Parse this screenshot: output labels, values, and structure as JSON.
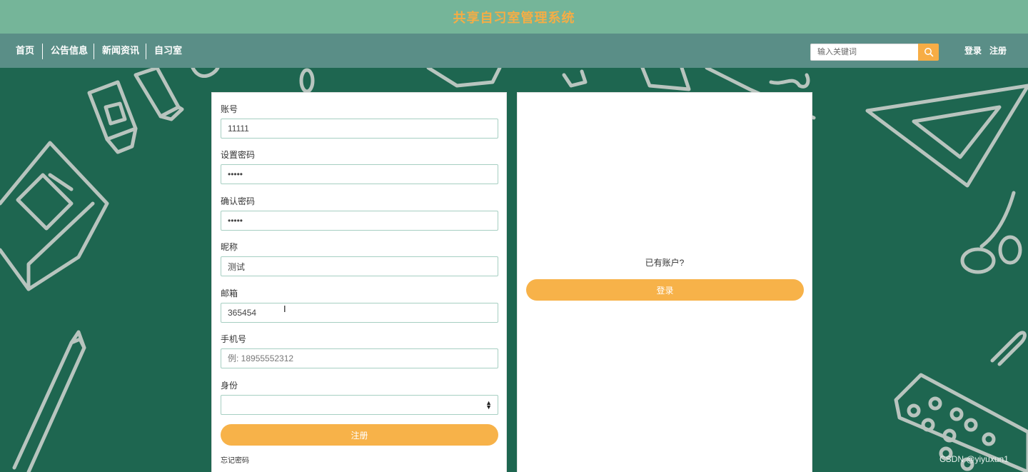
{
  "app": {
    "title": "共享自习室管理系统"
  },
  "nav": {
    "items": [
      {
        "label": "首页"
      },
      {
        "label": "公告信息"
      },
      {
        "label": "新闻资讯"
      },
      {
        "label": "自习室"
      }
    ]
  },
  "search": {
    "placeholder": "输入关键词",
    "icon": "search-icon"
  },
  "header_links": {
    "login": "登录",
    "register": "注册"
  },
  "form": {
    "account": {
      "label": "账号",
      "value": "11111"
    },
    "password": {
      "label": "设置密码",
      "value": "•••••"
    },
    "confirm_password": {
      "label": "确认密码",
      "value": "•••••"
    },
    "nickname": {
      "label": "昵称",
      "value": "测试"
    },
    "email": {
      "label": "邮箱",
      "value": "365454"
    },
    "phone": {
      "label": "手机号",
      "placeholder": "例: 18955552312"
    },
    "identity": {
      "label": "身份",
      "value": ""
    },
    "submit_label": "注册",
    "forgot_label": "忘记密码"
  },
  "side": {
    "question": "已有账户?",
    "login_label": "登录"
  },
  "watermark": "CSDN @yiyuxun1",
  "colors": {
    "title_bar": "#75b599",
    "nav_bar": "#5a8e87",
    "board": "#1e6650",
    "accent": "#f7b249",
    "title_text": "#f5ad45"
  }
}
